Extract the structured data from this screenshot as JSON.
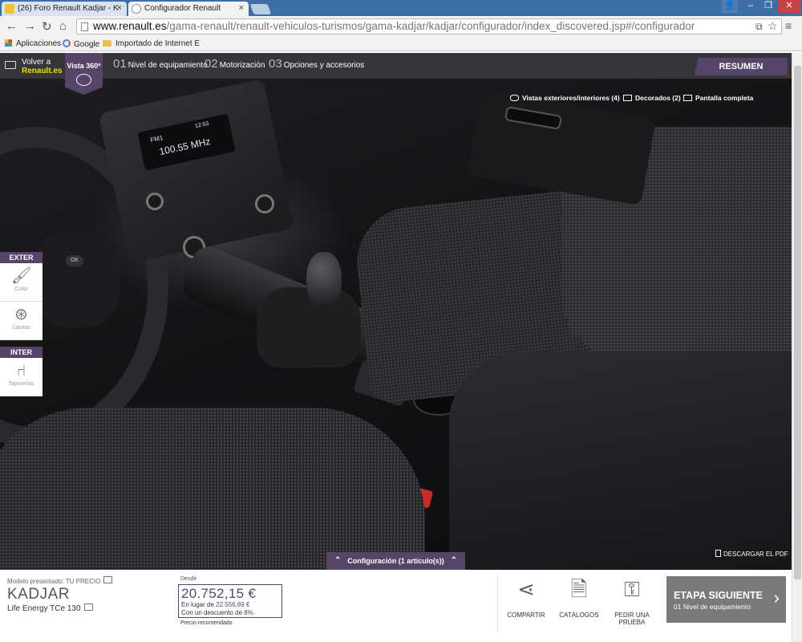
{
  "browser": {
    "tabs": [
      {
        "title": "(26) Foro Renault Kadjar - K",
        "favicon_text": "foro",
        "active": false
      },
      {
        "title": "Configurador Renault",
        "active": true
      }
    ],
    "window_controls": {
      "user": "👤",
      "minimize": "–",
      "maximize": "❐",
      "close": "✕"
    },
    "url": {
      "domain": "www.renault.es",
      "path": "/gama-renault/renault-vehiculos-turismos/gama-kadjar/kadjar/configurador/index_discovered.jsp#/configurador"
    },
    "bookmarks": [
      {
        "label": "Aplicaciones"
      },
      {
        "label": "Google"
      },
      {
        "label": "Importado de Internet E"
      }
    ],
    "translate_icon": "⧉",
    "star_icon": "☆",
    "menu_icon": "≡"
  },
  "header": {
    "back_line1": "Volver a",
    "back_line2": "Renault.es",
    "vista": "Vista 360º",
    "steps": [
      {
        "num": "01",
        "label": "Nivel de equipamiento"
      },
      {
        "num": "02",
        "label": "Motorización"
      },
      {
        "num": "03",
        "label": "Opciones y accesorios"
      }
    ],
    "resumen": "RESUMEN"
  },
  "viewer": {
    "tools": [
      {
        "label": "Vistas exteriores/interiores (4)"
      },
      {
        "label": "Decorados (2)"
      },
      {
        "label": "Pantalla completa"
      }
    ],
    "radio_text": "100.55 MHz",
    "radio_band": "FM1",
    "radio_clock": "12:53",
    "exter": "EXTER",
    "inter": "INTER",
    "side_items": {
      "color": "Color",
      "llantas": "Llantas",
      "tapicerias": "Tapicerías"
    },
    "config_tab": "Configuración (1 artículo(s))",
    "pdf": "DESCARGAR EL PDF"
  },
  "footer": {
    "model_label": "Modelo presentado: TU PRECIO",
    "model_name": "KADJAR",
    "version": "Life Energy TCe 130",
    "desde": "Desde",
    "price": "20.752,15 €",
    "instead_label": "En lugar de ",
    "instead_value": "22.556,69 €",
    "discount_label": "Con un descuento de ",
    "discount_value": "8%",
    "reco": "Precio recomendado",
    "actions": [
      {
        "label": "COMPARTIR"
      },
      {
        "label": "CATÁLOGOS"
      },
      {
        "label": "PEDIR UNA PRUEBA"
      }
    ],
    "etapa_title": "ETAPA SIGUIENTE",
    "etapa_sub": "01 Nivel de equipamiento"
  },
  "colors": {
    "accent": "#574469",
    "brand_yellow": "#efdf00",
    "header": "#35353a",
    "next_button": "#7a7a7a"
  }
}
